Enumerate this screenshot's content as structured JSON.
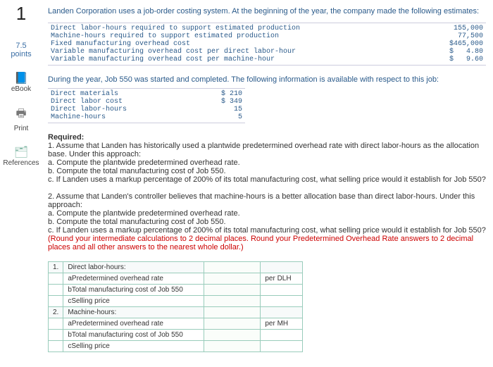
{
  "sidebar": {
    "qnum": "1",
    "points_value": "7.5",
    "points_label": "points",
    "ebook_label": "eBook",
    "print_label": "Print",
    "references_label": "References"
  },
  "intro": "Landen Corporation uses a job-order costing system. At the beginning of the year, the company made the following estimates:",
  "estimates": [
    {
      "label": "Direct labor-hours required to support estimated production",
      "value": "155,000"
    },
    {
      "label": "Machine-hours required to support estimated production",
      "value": "77,500"
    },
    {
      "label": "Fixed manufacturing overhead cost",
      "value": "$465,000"
    },
    {
      "label": "Variable manufacturing overhead cost per direct labor-hour",
      "value": "$   4.80"
    },
    {
      "label": "Variable manufacturing overhead cost per machine-hour",
      "value": "$   9.60"
    }
  ],
  "mid_text": "During the year, Job 550 was started and completed. The following information is available with respect to this job:",
  "job": [
    {
      "label": "Direct materials",
      "value": "$ 210"
    },
    {
      "label": "Direct labor cost",
      "value": "$ 349"
    },
    {
      "label": "Direct labor-hours",
      "value": "15"
    },
    {
      "label": "Machine-hours",
      "value": "5"
    }
  ],
  "req_title": "Required:",
  "req_lines": [
    "1. Assume that Landen has historically used a plantwide predetermined overhead rate with direct labor-hours as the allocation base. Under this approach:",
    "a. Compute the plantwide predetermined overhead rate.",
    "b. Compute the total manufacturing cost of Job 550.",
    "c. If Landen uses a markup percentage of 200% of its total manufacturing cost, what selling price would it establish for Job 550?",
    "",
    "2. Assume that Landen's controller believes that machine-hours is a better allocation base than direct labor-hours. Under this approach:",
    "a. Compute the plantwide predetermined overhead rate.",
    "b. Compute the total manufacturing cost of Job 550.",
    "c. If Landen uses a markup percentage of 200% of its total manufacturing cost, what selling price would it establish for Job 550?"
  ],
  "req_red": "(Round your intermediate calculations to 2 decimal places. Round your Predetermined Overhead Rate answers to 2 decimal places and all other answers to the nearest whole dollar.)",
  "answer": {
    "sec1_num": "1.",
    "sec1_head": "Direct labor-hours:",
    "r1a": "aPredetermined overhead rate",
    "u1a": "per DLH",
    "r1b": "bTotal manufacturing cost of Job 550",
    "r1c": "cSelling price",
    "sec2_num": "2.",
    "sec2_head": "Machine-hours:",
    "r2a": "aPredetermined overhead rate",
    "u2a": "per MH",
    "r2b": "bTotal manufacturing cost of Job 550",
    "r2c": "cSelling price"
  }
}
